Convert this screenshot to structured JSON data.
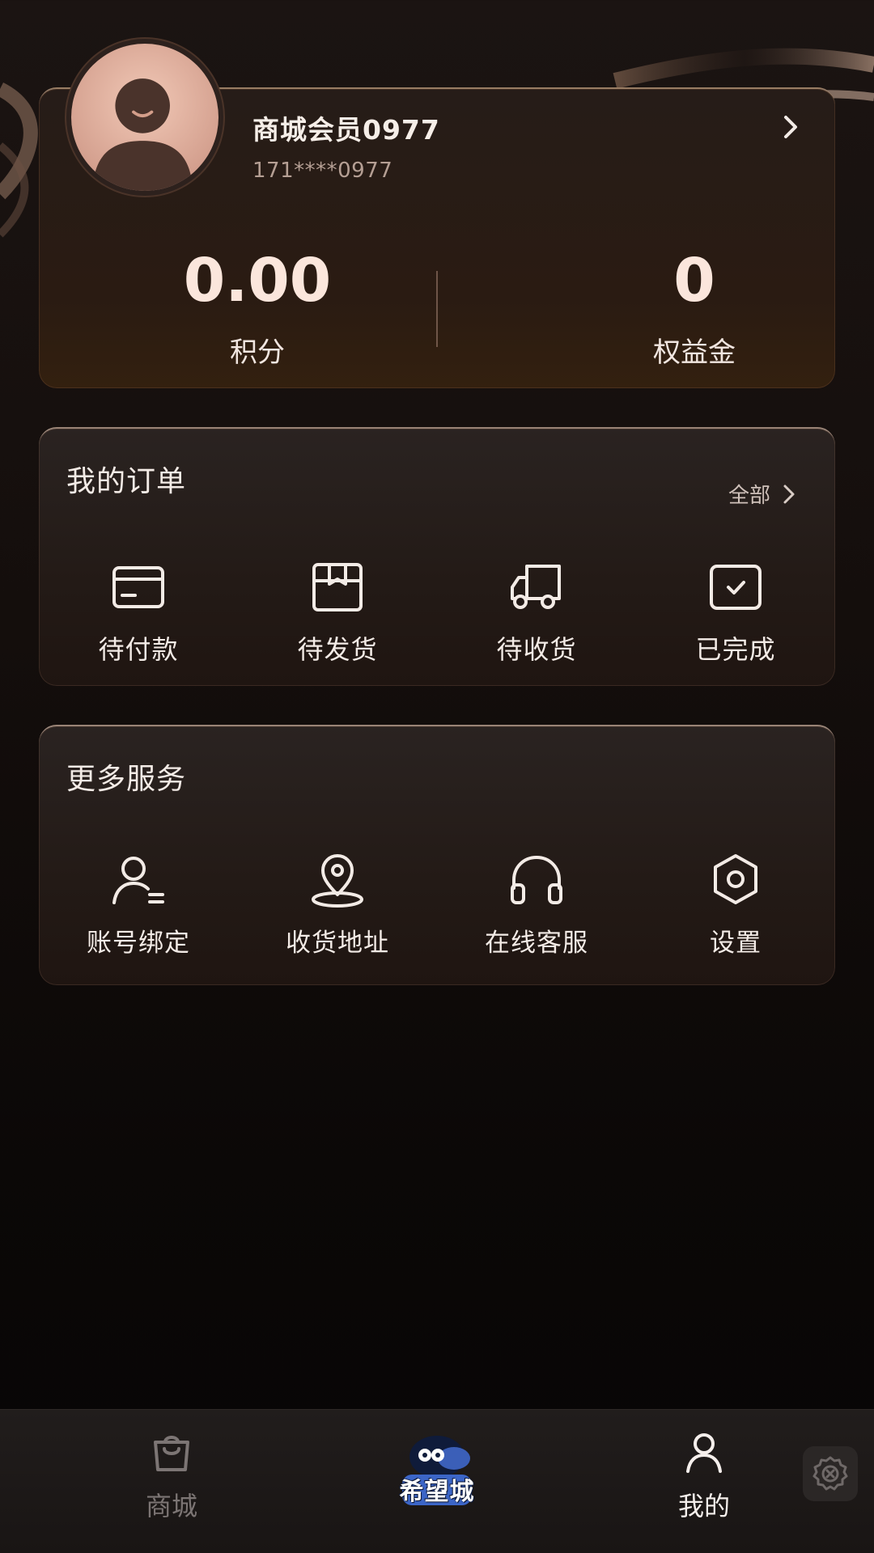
{
  "profile": {
    "member_name": "商城会员0977",
    "phone": "171****0977",
    "stats": [
      {
        "value": "0.00",
        "label": "积分"
      },
      {
        "value": "0",
        "label": "权益金"
      }
    ]
  },
  "orders": {
    "title": "我的订单",
    "more_label": "全部",
    "items": [
      {
        "label": "待付款",
        "icon": "card-icon"
      },
      {
        "label": "待发货",
        "icon": "package-icon"
      },
      {
        "label": "待收货",
        "icon": "truck-icon"
      },
      {
        "label": "已完成",
        "icon": "check-box-icon"
      }
    ]
  },
  "services": {
    "title": "更多服务",
    "items": [
      {
        "label": "账号绑定",
        "icon": "user-list-icon"
      },
      {
        "label": "收货地址",
        "icon": "location-pin-icon"
      },
      {
        "label": "在线客服",
        "icon": "headphones-icon"
      },
      {
        "label": "设置",
        "icon": "hexagon-gear-icon"
      }
    ]
  },
  "tabbar": {
    "tabs": [
      {
        "label": "商城",
        "icon": "shopping-bag-icon",
        "active": false
      },
      {
        "label": "希望城",
        "icon": "brand-logo",
        "active": false
      },
      {
        "label": "我的",
        "icon": "user-icon",
        "active": true
      }
    ]
  },
  "colors": {
    "accent_text": "#fbe6dc",
    "active_tab": "#f5efec",
    "inactive_tab": "#7c7574"
  }
}
